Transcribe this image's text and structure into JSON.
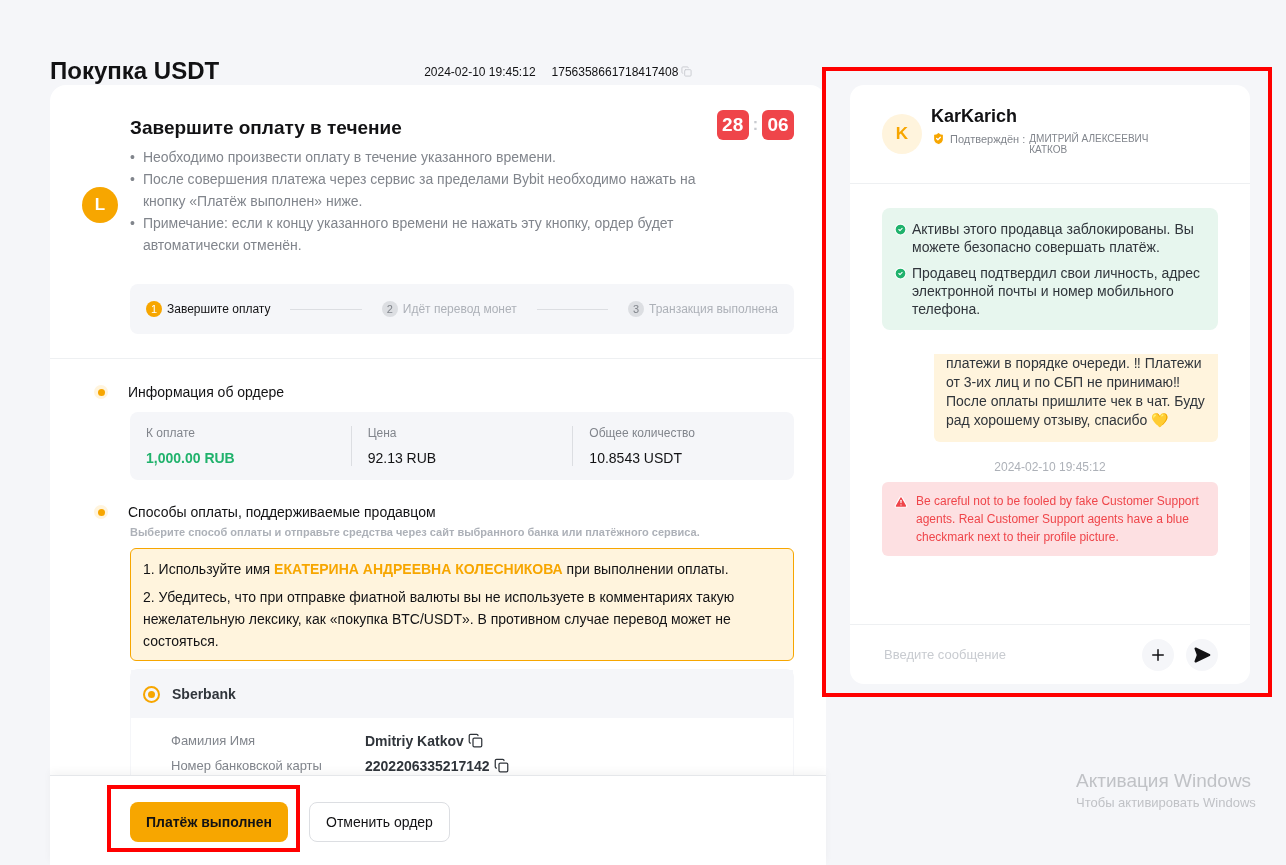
{
  "title": "Покупка USDT",
  "order_time": "2024-02-10 19:45:12",
  "order_id": "1756358661718417408",
  "timer": {
    "avatar_letter": "L",
    "title": "Завершите оплату в течение",
    "minutes": "28",
    "separator": ":",
    "seconds": "06",
    "bullets": [
      {
        "mark": "•",
        "text": "Необходимо произвести оплату в течение указанного времени."
      },
      {
        "mark": "•",
        "text": "После совершения платежа через сервис за пределами Bybit необходимо нажать на кнопку «Платёж выполнен» ниже."
      },
      {
        "mark": "•",
        "text": "Примечание: если к концу указанного времени не нажать эту кнопку, ордер будет автоматически отменён."
      }
    ]
  },
  "steps": [
    {
      "number": "1",
      "label": "Завершите оплату",
      "selected": true
    },
    {
      "number": "2",
      "label": "Идёт перевод монет",
      "selected": false
    },
    {
      "number": "3",
      "label": "Транзакция выполнена",
      "selected": false
    }
  ],
  "order_info": {
    "title": "Информация об ордере",
    "fields": [
      {
        "label": "К оплате",
        "value": "1,000.00 RUB",
        "kind": "amount"
      },
      {
        "label": "Цена",
        "value": "92.13 RUB",
        "kind": "plain"
      },
      {
        "label": "Общее количество",
        "value": "10.8543 USDT",
        "kind": "plain"
      }
    ]
  },
  "payment": {
    "title": "Способы оплаты, поддерживаемые продавцом",
    "hint": "Выберите способ оплаты и отправьте средства через сайт выбранного банка или платёжного сервиса.",
    "notice": [
      "1. Используйте имя **ЕКАТЕРИНА АНДРЕЕВНА КОЛЕСНИКОВА** при выполнении оплаты.",
      "2. Убедитесь, что при отправке фиатной валюты вы не используете в комментариях такую нежелательную лексику, как «покупка BTC/USDT». В противном случае перевод может не состояться."
    ],
    "method": {
      "name": "Sberbank",
      "selected": true,
      "details": [
        {
          "label": "Фамилия Имя",
          "value": "Dmitriy Katkov"
        },
        {
          "label": "Номер банковской карты",
          "value": "2202206335217142"
        }
      ]
    }
  },
  "actions": [
    {
      "label": "Платёж выполнен",
      "kind": "primary",
      "highlighted": true
    },
    {
      "label": "Отменить ордер",
      "kind": "secondary",
      "highlighted": false
    }
  ],
  "chat": {
    "highlighted": true,
    "avatar_letter": "K",
    "seller_name": "KarKarich",
    "verified_label": "Подтверждён :",
    "verified_name": "ДМИТРИЙ АЛЕКСЕЕВИЧ КАТКОВ",
    "notices": [
      "Активы этого продавца заблокированы. Вы можете безопасно совершать платёж.",
      "Продавец подтвердил свои личность, адрес электронной почты и номер мобильного телефона."
    ],
    "message": "платежи в порядке очереди. ‼ Платежи от 3-их лиц и по СБП не принимаю‼ После оплаты пришлите чек в чат. Буду рад хорошему отзыву, спасибо 💛",
    "timestamp": "2024-02-10 19:45:12",
    "warning": "Be careful not to be fooled by fake Customer Support agents. Real Customer Support agents have a blue checkmark next to their profile picture.",
    "input_placeholder": "Введите сообщение"
  },
  "os_notice": {
    "title": "Активация Windows",
    "subtitle": "Чтобы активировать Windows"
  }
}
